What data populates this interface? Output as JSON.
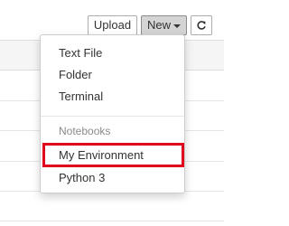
{
  "toolbar": {
    "upload_label": "Upload",
    "new_label": "New",
    "refresh_icon": "refresh-icon"
  },
  "new_menu": {
    "items": [
      {
        "label": "Text File"
      },
      {
        "label": "Folder"
      },
      {
        "label": "Terminal"
      }
    ],
    "section_header": "Notebooks",
    "notebook_items": [
      {
        "label": "My Environment",
        "highlighted": true
      },
      {
        "label": "Python 3"
      }
    ],
    "highlight_color": "#e0001b"
  }
}
